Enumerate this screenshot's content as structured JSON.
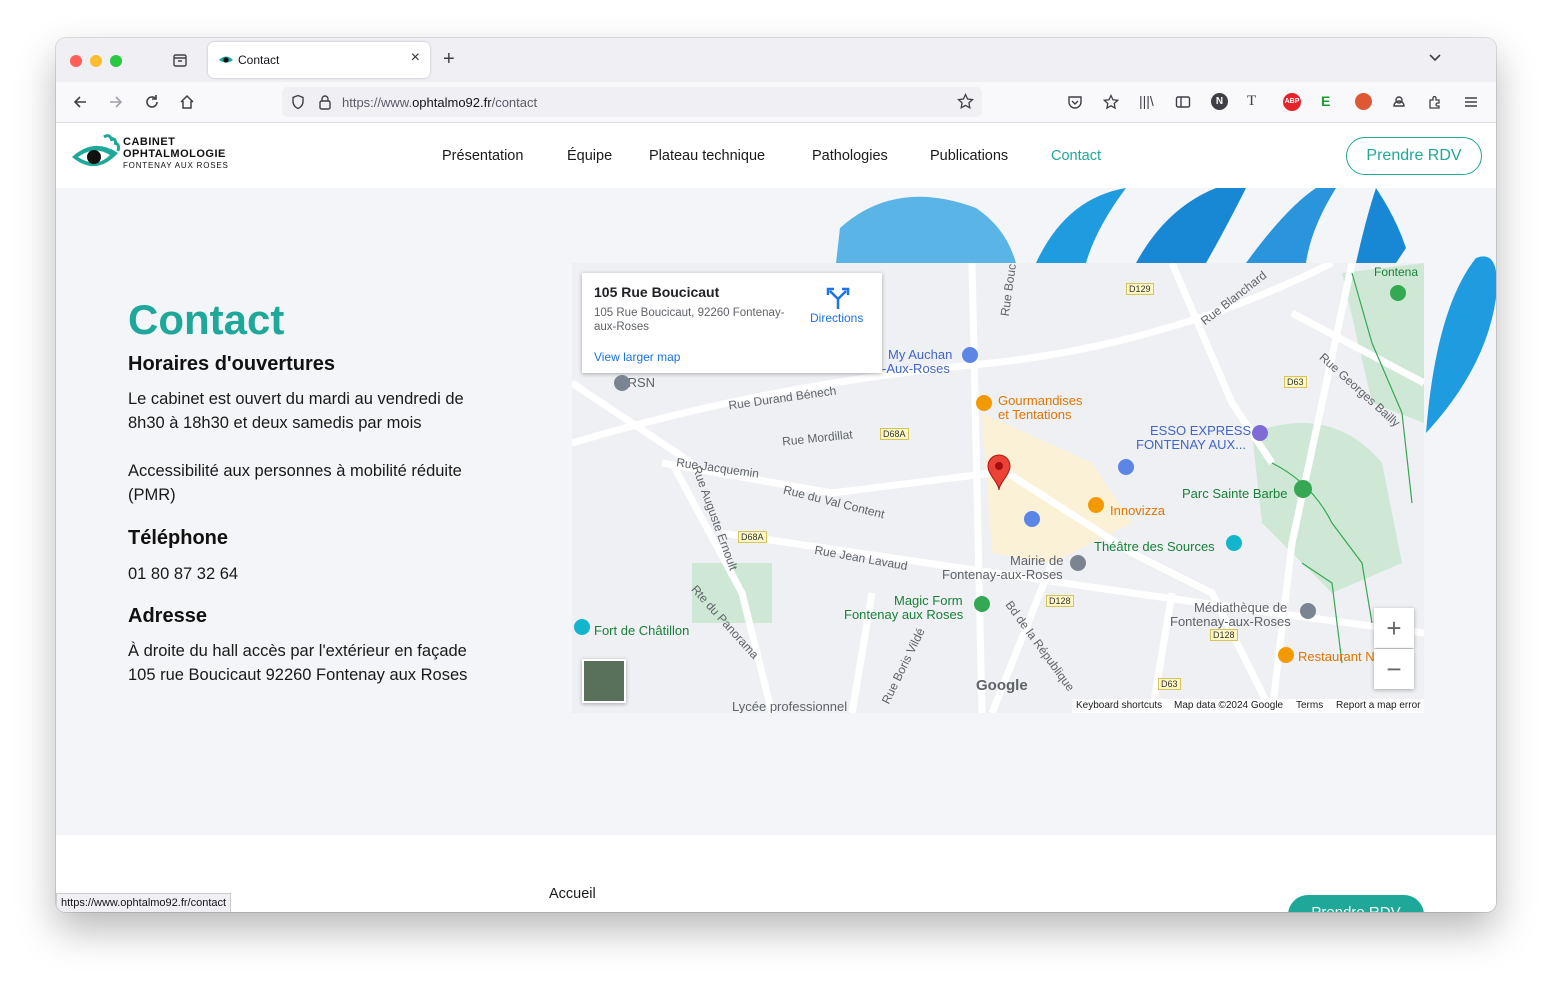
{
  "browser": {
    "tab_title": "Contact",
    "url_prefix": "https://www.",
    "url_domain": "ophtalmo92.fr",
    "url_path": "/contact",
    "status_url": "https://www.ophtalmo92.fr/contact"
  },
  "site": {
    "logo": {
      "line1": "CABINET",
      "line2": "OPHTALMOLOGIE",
      "line3": "FONTENAY AUX ROSES"
    },
    "nav": [
      {
        "label": "Présentation"
      },
      {
        "label": "Équipe"
      },
      {
        "label": "Plateau technique"
      },
      {
        "label": "Pathologies"
      },
      {
        "label": "Publications"
      },
      {
        "label": "Contact",
        "active": true
      }
    ],
    "cta_label": "Prendre RDV",
    "accent_color": "#1ea89a"
  },
  "contact": {
    "title": "Contact",
    "hours_heading": "Horaires d'ouvertures",
    "hours_line1": "Le cabinet est ouvert du mardi au vendredi de",
    "hours_line2": "8h30 à 18h30 et deux samedis par mois",
    "access_line1": "Accessibilité aux personnes à mobilité réduite",
    "access_line2": "(PMR)",
    "phone_heading": "Téléphone",
    "phone": "01 80 87 32 64",
    "address_heading": "Adresse",
    "address_line1": "À droite du hall accès par l'extérieur en façade",
    "address_line2": "105 rue Boucicaut 92260 Fontenay aux Roses"
  },
  "map": {
    "card_title": "105 Rue Boucicaut",
    "card_address_line1": "105 Rue Boucicaut, 92260 Fontenay-",
    "card_address_line2": "aux-Roses",
    "directions_label": "Directions",
    "larger_map_label": "View larger map",
    "places": [
      {
        "name": "IRSN"
      },
      {
        "name": "My Auchan"
      },
      {
        "name": "-Aux-Roses"
      },
      {
        "name": "Gourmandises"
      },
      {
        "name": "et Tentations"
      },
      {
        "name": "ESSO EXPRESS"
      },
      {
        "name": "FONTENAY AUX..."
      },
      {
        "name": "Parc Sainte Barbe"
      },
      {
        "name": "Innovizza"
      },
      {
        "name": "Théâtre des Sources"
      },
      {
        "name": "Mairie de"
      },
      {
        "name": "Fontenay-aux-Roses"
      },
      {
        "name": "Magic Form"
      },
      {
        "name": "Fontenay aux Roses"
      },
      {
        "name": "Fort de Châtillon"
      },
      {
        "name": "Médiathèque de"
      },
      {
        "name": "Fontenay-aux-Roses"
      },
      {
        "name": "Restaurant N"
      },
      {
        "name": "Lycée professionnel"
      },
      {
        "name": "Fontena"
      }
    ],
    "streets": [
      {
        "name": "Rue Durand Bénech"
      },
      {
        "name": "Rue Mordillat"
      },
      {
        "name": "Rue Jacquemin"
      },
      {
        "name": "Rue du Val Content"
      },
      {
        "name": "Rue Jean Lavaud"
      },
      {
        "name": "Rte du Panorama"
      },
      {
        "name": "Rue Auguste Ernoult"
      },
      {
        "name": "Bd de la République"
      },
      {
        "name": "Rue Boris Vildé"
      },
      {
        "name": "Rue Blanchard"
      },
      {
        "name": "Rue Georges Bailly"
      },
      {
        "name": "Rue Bouc"
      }
    ],
    "road_badges": [
      "D129",
      "D63",
      "D68A",
      "D68A",
      "D128",
      "D128",
      "D63"
    ],
    "footer": {
      "shortcuts": "Keyboard shortcuts",
      "data": "Map data ©2024 Google",
      "terms": "Terms",
      "report": "Report a map error"
    },
    "google_label": "Google"
  },
  "footer": {
    "accueil": "Accueil",
    "cta_label": "Prendre RDV"
  }
}
